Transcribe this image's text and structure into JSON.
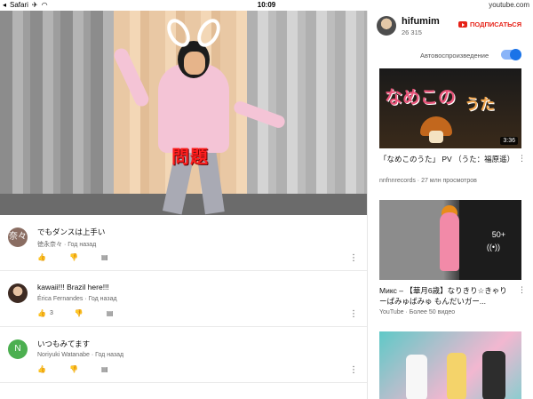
{
  "status_bar": {
    "app": "Safari",
    "time": "10:09",
    "url": "youtube.com"
  },
  "video": {
    "caption": "問題"
  },
  "comments": [
    {
      "avatar_text": "奈々",
      "avatar_color": "#8a6d62",
      "text": "でもダンスは上手い",
      "author": "徳永奈々",
      "time": "Год назад",
      "likes": ""
    },
    {
      "avatar_text": "",
      "avatar_color": "#3d2a22",
      "text": "kawaii!!! Brazil here!!!",
      "author": "Érica Fernandes",
      "time": "Год назад",
      "likes": "3"
    },
    {
      "avatar_text": "N",
      "avatar_color": "#4caf50",
      "text": "いつもみてます",
      "author": "Noriyuki Watanabe",
      "time": "Год назад",
      "likes": ""
    }
  ],
  "channel": {
    "name": "hifumim",
    "subscribers": "26 315",
    "subscribe_label": "ПОДПИСАТЬСЯ",
    "autoplay_label": "Автовоспроизведение",
    "autoplay_on": true
  },
  "recommendations": [
    {
      "title": "「なめこのうた」 PV （うた：福原遥）",
      "meta": "nnfnnrecords · 27 млн просмотров",
      "duration": "3:36",
      "thumb_text_1": "なめこの",
      "thumb_text_2": "うた"
    },
    {
      "title": "Микс – 【華月6歳】なりきり☆きゃりーぱみゅぱみゅ もんだいガー...",
      "meta": "YouTube · Более 50 видео",
      "playlist_count": "50+",
      "playlist_icon": "((•))"
    },
    {
      "title": "",
      "meta": ""
    }
  ],
  "icons": {
    "like": "like-icon",
    "dislike": "dislike-icon",
    "reply": "reply-icon",
    "more": "more-vert-icon",
    "subscribe_logo": "youtube-logo-icon"
  },
  "colors": {
    "accent_red": "#e62117",
    "toggle_blue": "#1a73e8"
  }
}
